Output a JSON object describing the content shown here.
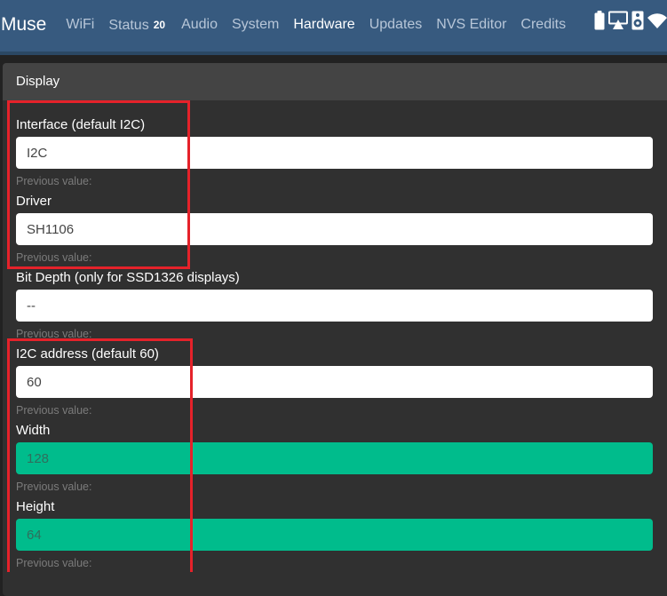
{
  "app": {
    "brand": "Muse"
  },
  "nav": {
    "items": [
      {
        "label": "WiFi"
      },
      {
        "label": "Status",
        "badge": "20"
      },
      {
        "label": "Audio"
      },
      {
        "label": "System"
      },
      {
        "label": "Hardware"
      },
      {
        "label": "Updates"
      },
      {
        "label": "NVS Editor"
      },
      {
        "label": "Credits"
      }
    ],
    "active": "Hardware",
    "status_icons": [
      "battery-icon",
      "airplay-icon",
      "speaker-icon",
      "wifi-icon"
    ]
  },
  "panel": {
    "title": "Display",
    "fields": [
      {
        "label": "Interface (default I2C)",
        "value": "I2C",
        "previous_label": "Previous value:",
        "changed": false
      },
      {
        "label": "Driver",
        "value": "SH1106",
        "previous_label": "Previous value:",
        "changed": false
      },
      {
        "label": "Bit Depth (only for SSD1326 displays)",
        "value": "--",
        "previous_label": "Previous value:",
        "changed": false
      },
      {
        "label": "I2C address (default 60)",
        "value": "60",
        "previous_label": "Previous value:",
        "changed": false
      },
      {
        "label": "Width",
        "value": "128",
        "previous_label": "Previous value:",
        "changed": true
      },
      {
        "label": "Height",
        "value": "64",
        "previous_label": "Previous value:",
        "changed": true
      }
    ]
  },
  "colors": {
    "navbar": "#375a7f",
    "background": "#222222",
    "card": "#303030",
    "card_header": "#444444",
    "changed_field": "#00bc8c",
    "highlight": "#e5222a"
  }
}
